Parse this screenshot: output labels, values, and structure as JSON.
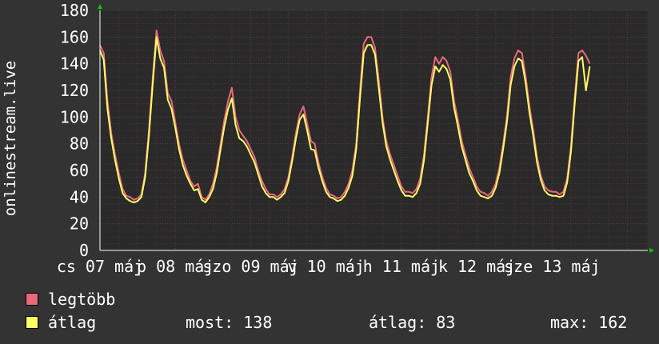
{
  "colors": {
    "background": "#333333",
    "plot": "#2a2a2a",
    "grid_major": "#5a3a3a",
    "grid_minor": "#4a3333",
    "max_line": "#e86a7a",
    "avg_line": "#ffff66",
    "axis_arrow": "#00cc00"
  },
  "legend": {
    "max_label": "legtöbb",
    "avg_label": "átlag"
  },
  "stats": {
    "now": "most: 138",
    "avg": "átlag: 83",
    "max": "max: 162"
  },
  "chart_data": {
    "type": "line",
    "ylabel": "onlinestream.live",
    "ylim": [
      0,
      180
    ],
    "yticks": [
      0,
      20,
      40,
      60,
      80,
      100,
      120,
      140,
      160,
      180
    ],
    "xlim": [
      0,
      7.27
    ],
    "xtick_labels": [
      {
        "pos": 0.0,
        "text": "cs 07 máj"
      },
      {
        "pos": 1.0,
        "text": "p 08 máj"
      },
      {
        "pos": 2.0,
        "text": "szo 09 máj"
      },
      {
        "pos": 3.0,
        "text": "v 10 máj"
      },
      {
        "pos": 4.0,
        "text": "h 11 máj"
      },
      {
        "pos": 5.0,
        "text": "k 12 máj"
      },
      {
        "pos": 6.0,
        "text": "sze 13 máj"
      }
    ],
    "grid": true,
    "x": [
      0.0,
      0.05,
      0.1,
      0.15,
      0.2,
      0.25,
      0.3,
      0.35,
      0.4,
      0.45,
      0.5,
      0.55,
      0.6,
      0.65,
      0.7,
      0.75,
      0.8,
      0.85,
      0.9,
      0.95,
      1.0,
      1.05,
      1.1,
      1.15,
      1.2,
      1.25,
      1.3,
      1.35,
      1.4,
      1.45,
      1.5,
      1.55,
      1.6,
      1.65,
      1.7,
      1.75,
      1.8,
      1.85,
      1.9,
      1.95,
      2.0,
      2.05,
      2.1,
      2.15,
      2.2,
      2.25,
      2.3,
      2.35,
      2.4,
      2.45,
      2.5,
      2.55,
      2.6,
      2.65,
      2.7,
      2.75,
      2.8,
      2.85,
      2.9,
      2.95,
      3.0,
      3.05,
      3.1,
      3.15,
      3.2,
      3.25,
      3.3,
      3.35,
      3.4,
      3.45,
      3.5,
      3.55,
      3.6,
      3.65,
      3.7,
      3.75,
      3.8,
      3.85,
      3.9,
      3.95,
      4.0,
      4.05,
      4.1,
      4.15,
      4.2,
      4.25,
      4.3,
      4.35,
      4.4,
      4.45,
      4.5,
      4.55,
      4.6,
      4.65,
      4.7,
      4.75,
      4.8,
      4.85,
      4.9,
      4.95,
      5.0,
      5.05,
      5.1,
      5.15,
      5.2,
      5.25,
      5.3,
      5.35,
      5.4,
      5.45,
      5.5,
      5.55,
      5.6,
      5.65,
      5.7,
      5.75,
      5.8,
      5.85,
      5.9,
      5.95,
      6.0,
      6.05,
      6.1,
      6.15,
      6.2,
      6.25,
      6.3,
      6.35,
      6.4,
      6.45,
      6.5,
      6.55,
      6.6,
      6.65,
      6.7,
      6.75,
      6.8,
      6.85,
      6.9,
      6.95,
      7.0,
      7.05,
      7.1,
      7.15,
      7.2,
      7.25
    ],
    "series": [
      {
        "name": "legtöbb",
        "values": [
          154,
          148,
          112,
          88,
          72,
          58,
          46,
          41,
          40,
          38,
          39,
          42,
          58,
          90,
          130,
          165,
          150,
          142,
          118,
          112,
          96,
          80,
          68,
          60,
          52,
          48,
          50,
          40,
          38,
          42,
          50,
          62,
          80,
          98,
          112,
          122,
          100,
          90,
          86,
          82,
          76,
          70,
          60,
          52,
          46,
          42,
          42,
          40,
          42,
          46,
          55,
          70,
          88,
          102,
          108,
          95,
          82,
          80,
          66,
          55,
          47,
          42,
          41,
          39,
          40,
          44,
          50,
          60,
          80,
          120,
          155,
          160,
          160,
          152,
          128,
          100,
          82,
          72,
          64,
          56,
          48,
          44,
          44,
          43,
          46,
          54,
          72,
          100,
          130,
          145,
          140,
          145,
          142,
          134,
          112,
          98,
          82,
          72,
          62,
          55,
          48,
          44,
          43,
          41,
          44,
          50,
          62,
          80,
          100,
          130,
          144,
          150,
          148,
          130,
          108,
          90,
          70,
          56,
          48,
          45,
          44,
          44,
          42,
          44,
          54,
          78,
          115,
          148,
          150,
          146,
          140
        ]
      },
      {
        "name": "átlag",
        "values": [
          150,
          143,
          106,
          84,
          68,
          54,
          43,
          39,
          37,
          36,
          37,
          40,
          55,
          86,
          125,
          160,
          144,
          137,
          113,
          106,
          92,
          76,
          64,
          56,
          50,
          45,
          46,
          38,
          36,
          40,
          46,
          58,
          76,
          93,
          106,
          114,
          94,
          84,
          82,
          78,
          72,
          66,
          57,
          48,
          43,
          40,
          40,
          38,
          40,
          43,
          52,
          67,
          84,
          98,
          102,
          90,
          76,
          75,
          62,
          52,
          44,
          40,
          39,
          37,
          38,
          41,
          47,
          56,
          76,
          114,
          148,
          154,
          154,
          147,
          122,
          96,
          78,
          68,
          60,
          52,
          45,
          41,
          41,
          40,
          43,
          50,
          68,
          96,
          124,
          138,
          134,
          139,
          136,
          128,
          107,
          93,
          78,
          68,
          58,
          52,
          45,
          41,
          40,
          39,
          41,
          47,
          58,
          76,
          96,
          124,
          138,
          144,
          142,
          125,
          103,
          86,
          66,
          53,
          45,
          42,
          41,
          41,
          40,
          41,
          51,
          74,
          110,
          142,
          145,
          120,
          138
        ]
      }
    ]
  }
}
